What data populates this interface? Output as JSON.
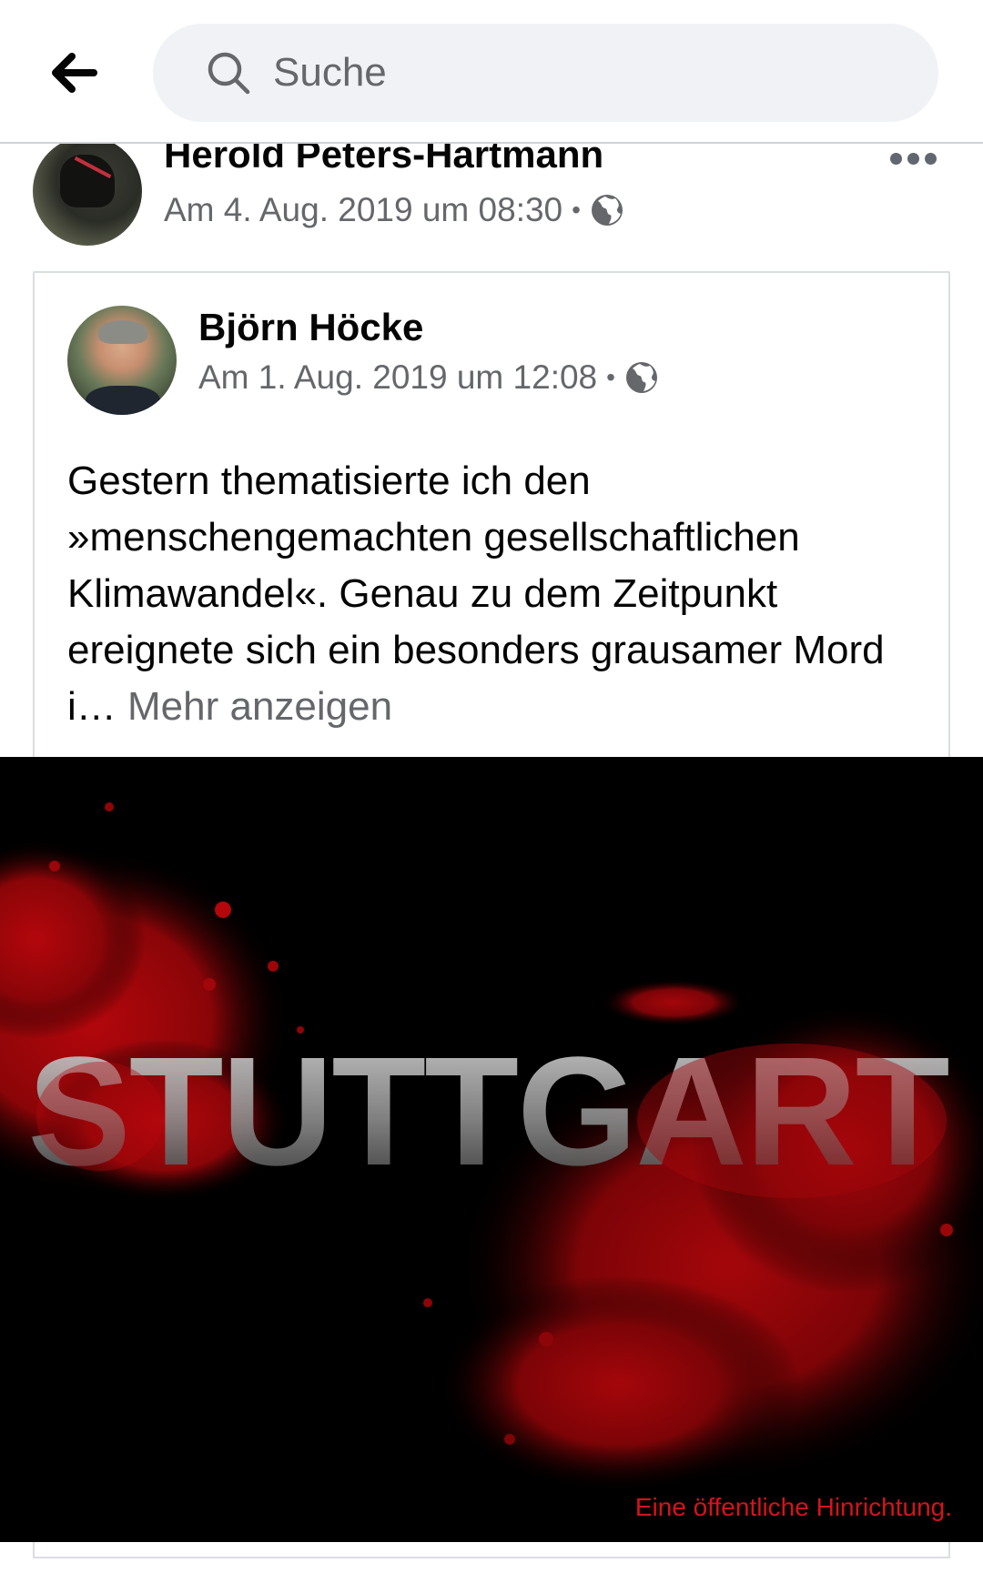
{
  "search": {
    "placeholder": "Suche"
  },
  "outer_post": {
    "author": "Herold Peters-Hartmann",
    "timestamp": "Am 4. Aug. 2019 um 08:30",
    "separator": "•",
    "privacy_icon": "globe-icon"
  },
  "shared_post": {
    "author": "Björn Höcke",
    "timestamp": "Am 1. Aug. 2019 um 12:08",
    "separator": "•",
    "privacy_icon": "globe-icon",
    "text": "Gestern thematisierte ich den »menschengemachten gesellschaftlichen Klimawandel«. Genau zu dem Zeitpunkt ereignete sich ein besonders grausamer Mord i… ",
    "see_more": "Mehr anzeigen",
    "image": {
      "headline": "STUTTGART",
      "caption": "Eine öffentliche Hinrichtung.",
      "colors": {
        "background": "#000000",
        "blood": "#b3070c",
        "caption": "#d4141b"
      }
    }
  },
  "icons": [
    "back-arrow-icon",
    "search-icon",
    "more-icon",
    "globe-icon"
  ]
}
